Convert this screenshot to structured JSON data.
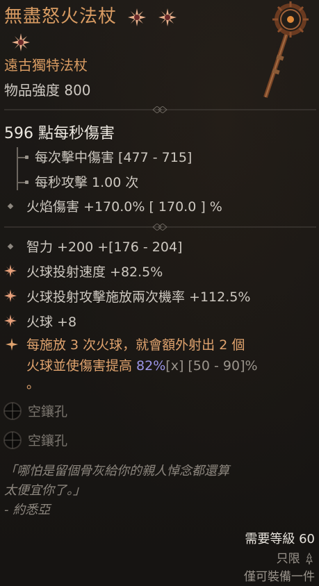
{
  "item": {
    "name": "無盡怒火法杖",
    "type": "遠古獨特法杖",
    "power": "物品強度 800"
  },
  "stats": {
    "dps": "596 點每秒傷害",
    "damage_per_hit": "每次擊中傷害 [477 - 715]",
    "attacks_per_second": "每秒攻擊 1.00 次",
    "fire_damage": "火焰傷害 +170.0%   [ 170.0 ] %"
  },
  "affixes": {
    "intelligence": "智力 +200 +[176 - 204]",
    "fireball_speed": "火球投射速度 +82.5%",
    "fireball_double_cast": "火球投射攻擊施放兩次機率 +112.5%",
    "fireball_rank": "火球 +8"
  },
  "legendary": {
    "line1": "每施放 3 次火球，就會額外射出 2 個",
    "line2_prefix": "火球並使傷害提高 ",
    "line2_value": "82%",
    "line2_mark": "[x]",
    "line2_range": " [50 - 90]%",
    "line3": "。"
  },
  "sockets": [
    {
      "label": "空鑲孔"
    },
    {
      "label": "空鑲孔"
    }
  ],
  "flavor": {
    "line1": "「哪怕是留個骨灰給你的親人悼念都還算",
    "line2": "太便宜你了。」",
    "author": "- 約悉亞"
  },
  "requirements": {
    "level": "需要等級 60",
    "class": "只限",
    "equip": "僅可裝備一件"
  },
  "icons": {
    "gem": "orange-star-gem-icon",
    "bullet": "diamond-bullet-icon",
    "star": "starburst-affix-icon",
    "legendary": "legendary-sparkle-icon",
    "socket": "empty-socket-icon",
    "class": "sorcerer-class-icon"
  },
  "colors": {
    "legendary_orange": "#d89b62",
    "value_purple": "#9c96e8",
    "text": "#cdc8c0"
  }
}
